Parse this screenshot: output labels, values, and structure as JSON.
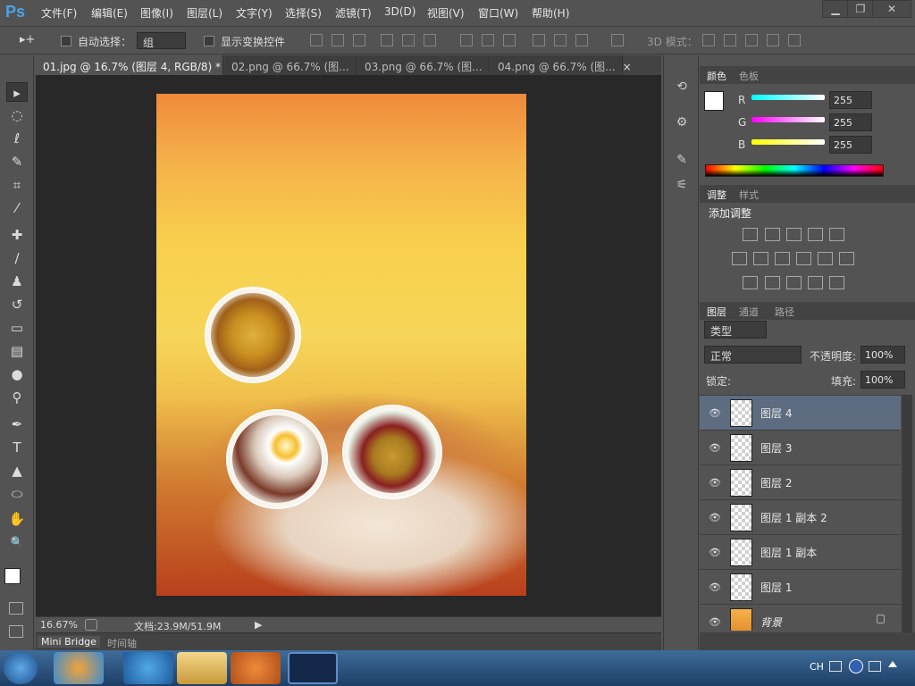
{
  "app": {
    "logo": "Ps",
    "menus": [
      "文件(F)",
      "编辑(E)",
      "图像(I)",
      "图层(L)",
      "文字(Y)",
      "选择(S)",
      "滤镜(T)",
      "3D(D)",
      "视图(V)",
      "窗口(W)",
      "帮助(H)"
    ],
    "window_controls": [
      "minimize-icon",
      "restore-icon",
      "close-icon"
    ],
    "window_control_glyphs": [
      "▁",
      "❐",
      "✕"
    ]
  },
  "options": {
    "tool_glyph": "▸+",
    "auto_select": "自动选择：",
    "auto_select_value": "组",
    "show_transform": "显示变换控件",
    "mode3d": "3D 模式："
  },
  "tabs": [
    {
      "label": "01.jpg @ 16.7% (图层 4, RGB/8) *",
      "active": true
    },
    {
      "label": "02.png @ 66.7% (图...",
      "active": false
    },
    {
      "label": "03.png @ 66.7% (图...",
      "active": false
    },
    {
      "label": "04.png @ 66.7% (图...",
      "active": false
    }
  ],
  "close_glyph": "×",
  "tools": [
    "move-icon",
    "marquee-icon",
    "lasso-icon",
    "quick-select-icon",
    "crop-icon",
    "eyedropper-icon",
    "healing-brush-icon",
    "brush-icon",
    "stamp-icon",
    "history-brush-icon",
    "eraser-icon",
    "gradient-icon",
    "blur-icon",
    "dodge-icon",
    "pen-icon",
    "type-icon",
    "path-select-icon",
    "ellipse-icon",
    "hand-icon",
    "zoom-icon"
  ],
  "tool_glyphs": [
    "▸",
    "◌",
    "ℓ",
    "✎",
    "⌗",
    "⁄",
    "✚",
    "∕",
    "♟",
    "↺",
    "▭",
    "▤",
    "●",
    "⚲",
    "✒",
    "T",
    "▲",
    "⬭",
    "✋",
    "🔍"
  ],
  "status": {
    "zoom": "16.67%",
    "doc": "文档:23.9M/51.9M",
    "play_glyph": "▶"
  },
  "bottom_tabs": [
    "Mini Bridge",
    "时间轴"
  ],
  "color_panel": {
    "tabs": [
      "颜色",
      "色板"
    ],
    "channels": [
      {
        "name": "R",
        "value": "255"
      },
      {
        "name": "G",
        "value": "255"
      },
      {
        "name": "B",
        "value": "255"
      }
    ]
  },
  "adjust_panel": {
    "tabs": [
      "调整",
      "样式"
    ],
    "title": "添加调整",
    "icons": [
      "brightness-icon",
      "levels-icon",
      "curves-icon",
      "exposure-icon",
      "vibrance-icon",
      "hsl-icon",
      "color-balance-icon",
      "bw-icon",
      "photo-filter-icon",
      "channel-mixer-icon",
      "color-lookup-icon",
      "invert-icon",
      "posterize-icon",
      "threshold-icon",
      "gradient-map-icon",
      "selective-color-icon"
    ]
  },
  "layers_panel": {
    "tabs": [
      "图层",
      "通道",
      "路径"
    ],
    "filter": "类型",
    "blend": "正常",
    "opacity_label": "不透明度:",
    "opacity": "100%",
    "lock_label": "锁定:",
    "fill_label": "填充:",
    "fill": "100%",
    "eye_glyph": "👁",
    "layers": [
      {
        "name": "图层 4",
        "selected": true
      },
      {
        "name": "图层 3",
        "selected": false
      },
      {
        "name": "图层 2",
        "selected": false
      },
      {
        "name": "图层 1 副本 2",
        "selected": false
      },
      {
        "name": "图层 1 副本",
        "selected": false
      },
      {
        "name": "图层 1",
        "selected": false
      },
      {
        "name": "背景",
        "selected": false,
        "locked": true
      }
    ]
  },
  "taskbar": {
    "tray": "CH"
  }
}
